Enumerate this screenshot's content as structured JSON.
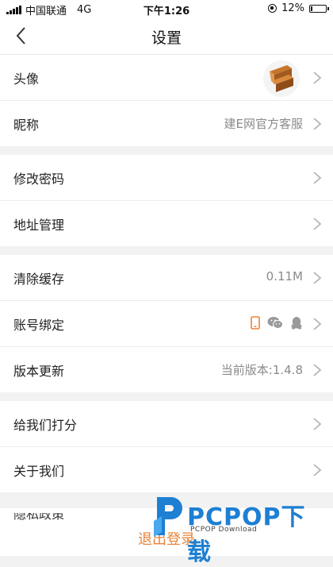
{
  "status_bar": {
    "carrier": "中国联通",
    "network": "4G",
    "time": "下午1:26",
    "battery_percent": "12%",
    "battery_level": 0.12
  },
  "header": {
    "title": "设置"
  },
  "groups": [
    {
      "items": [
        {
          "label": "头像",
          "value": ""
        },
        {
          "label": "昵称",
          "value": "建E网官方客服"
        }
      ]
    },
    {
      "items": [
        {
          "label": "修改密码",
          "value": ""
        },
        {
          "label": "地址管理",
          "value": ""
        }
      ]
    },
    {
      "items": [
        {
          "label": "清除缓存",
          "value": "0.11M"
        },
        {
          "label": "账号绑定",
          "value": "",
          "icons": [
            "phone-icon",
            "wechat-icon",
            "qq-icon"
          ]
        },
        {
          "label": "版本更新",
          "value": "当前版本:1.4.8"
        }
      ]
    },
    {
      "items": [
        {
          "label": "给我们打分",
          "value": ""
        },
        {
          "label": "关于我们",
          "value": ""
        }
      ]
    }
  ],
  "partial_item": "隐私政策",
  "logout_label": "退出登录",
  "watermark": {
    "brand": "PCPOP下载",
    "sub": "PCPOP Download"
  },
  "colors": {
    "accent": "#e8843a",
    "background": "#f2f2f2",
    "watermark": "#1e7fd3"
  }
}
